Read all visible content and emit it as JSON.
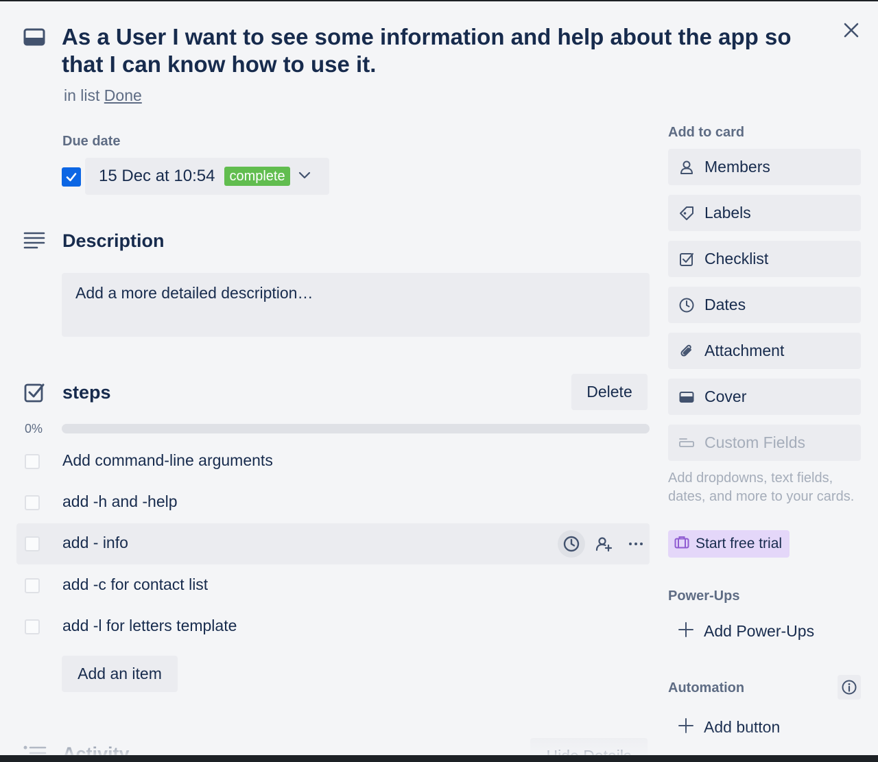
{
  "card": {
    "title": "As a User I want to see some information and help about the app so that I can know how to use it.",
    "in_list_prefix": "in list",
    "list_name": "Done"
  },
  "due": {
    "label": "Due date",
    "checked": true,
    "date_text": "15 Dec at 10:54",
    "status": "complete"
  },
  "description": {
    "heading": "Description",
    "placeholder": "Add a more detailed description…"
  },
  "checklist": {
    "title": "steps",
    "delete_label": "Delete",
    "progress_text": "0%",
    "progress_value": 0,
    "items": [
      {
        "text": "Add command-line arguments",
        "checked": false
      },
      {
        "text": "add -h and -help",
        "checked": false
      },
      {
        "text": "add - info",
        "checked": false,
        "hovered": true
      },
      {
        "text": "add -c for contact list",
        "checked": false
      },
      {
        "text": "add -l for letters template",
        "checked": false
      }
    ],
    "add_item_label": "Add an item"
  },
  "activity": {
    "heading": "Activity",
    "hide_details_label": "Hide Details"
  },
  "sidebar": {
    "add_to_card_heading": "Add to card",
    "buttons": [
      {
        "label": "Members",
        "icon": "person-icon"
      },
      {
        "label": "Labels",
        "icon": "tag-icon"
      },
      {
        "label": "Checklist",
        "icon": "checklist-icon"
      },
      {
        "label": "Dates",
        "icon": "clock-icon"
      },
      {
        "label": "Attachment",
        "icon": "paperclip-icon"
      },
      {
        "label": "Cover",
        "icon": "cover-icon"
      },
      {
        "label": "Custom Fields",
        "icon": "custom-fields-icon",
        "disabled": true
      }
    ],
    "custom_fields_note": "Add dropdowns, text fields, dates, and more to your cards.",
    "trial_label": "Start free trial",
    "powerups_heading": "Power-Ups",
    "add_powerups_label": "Add Power-Ups",
    "automation_heading": "Automation",
    "add_button_label": "Add button"
  },
  "colors": {
    "accent_blue": "#0c66e4",
    "complete_green": "#61bd4f",
    "trial_purple": "#e4d7f9",
    "panel_bg": "#f4f5f7",
    "button_bg": "#ebecf0"
  }
}
